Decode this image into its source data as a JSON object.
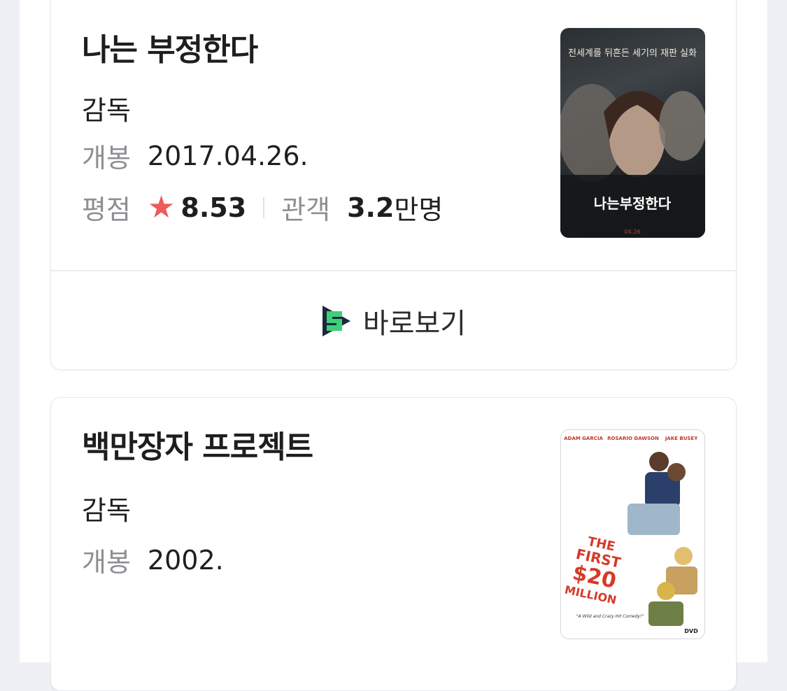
{
  "movies": [
    {
      "title": "나는 부정한다",
      "director_label": "감독",
      "release_label": "개봉",
      "release_date": "2017.04.26.",
      "rating_label": "평점",
      "rating": "8.53",
      "audience_label": "관객",
      "audience_number": "3.2",
      "audience_unit": "만명",
      "watch_label": "바로보기",
      "poster_text": {
        "tagline": "전세계를 뒤흔든 세기의 재판 실화",
        "title": "나는부정한다",
        "date": "04.26"
      }
    },
    {
      "title": "백만장자 프로젝트",
      "director_label": "감독",
      "release_label": "개봉",
      "release_date": "2002.",
      "poster_text": {
        "cast": [
          "ADAM GARCIA",
          "ROSARIO DAWSON",
          "JAKE BUSEY"
        ],
        "title_line1": "THE",
        "title_line2": "FIRST",
        "title_line3": "$20",
        "title_line4": "MILLION",
        "quote": "\"A Wild and Crazy Hit Comedy!\"",
        "logo": "DVD"
      }
    }
  ],
  "colors": {
    "star": "#ec5b5b",
    "label": "#8e8e93",
    "watch_icon_green": "#3ecf7a",
    "watch_icon_dark": "#1a2a3a"
  },
  "icons": {
    "rating": "star-icon",
    "watch": "play-service-icon"
  }
}
